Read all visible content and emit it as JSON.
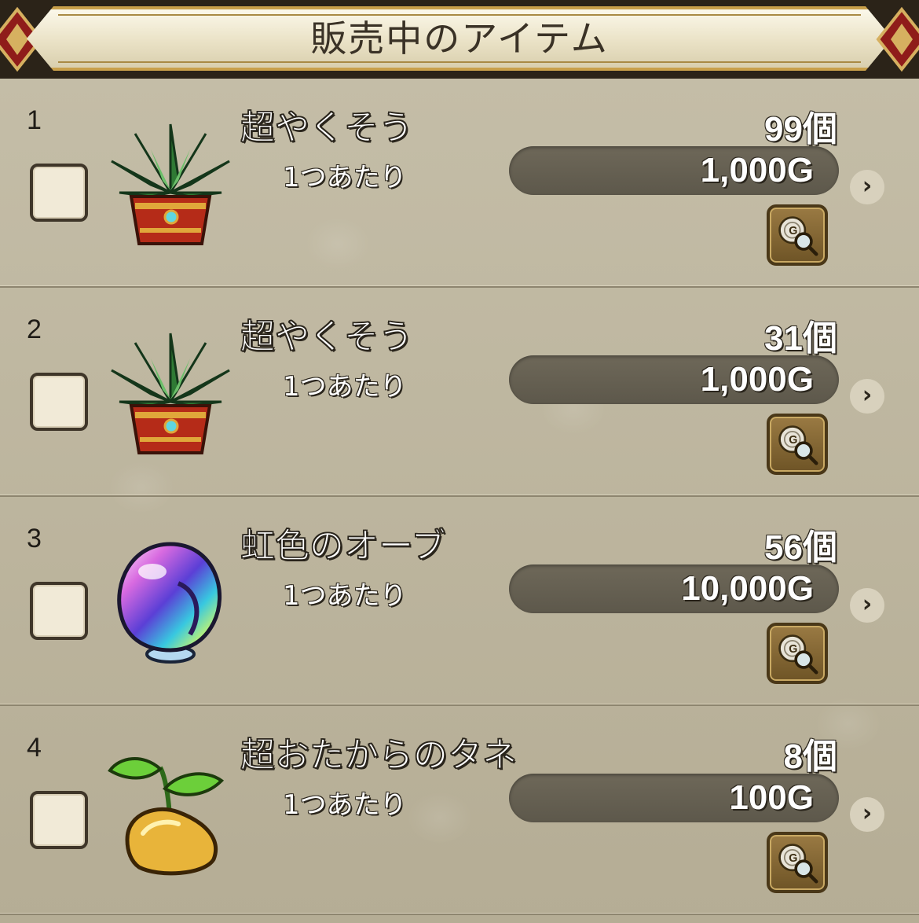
{
  "header": {
    "title": "販売中のアイテム"
  },
  "items": [
    {
      "number": "1",
      "name": "超やくそう",
      "quantity": "99個",
      "per_unit_label": "1つあたり",
      "price": "1,000G",
      "icon": "herb-icon"
    },
    {
      "number": "2",
      "name": "超やくそう",
      "quantity": "31個",
      "per_unit_label": "1つあたり",
      "price": "1,000G",
      "icon": "herb-icon"
    },
    {
      "number": "3",
      "name": "虹色のオーブ",
      "quantity": "56個",
      "per_unit_label": "1つあたり",
      "price": "10,000G",
      "icon": "rainbow-orb-icon"
    },
    {
      "number": "4",
      "name": "超おたからのタネ",
      "quantity": "8個",
      "per_unit_label": "1つあたり",
      "price": "100G",
      "icon": "seed-icon"
    }
  ],
  "colors": {
    "background": "#b9b29c",
    "header_plate": "#f2edd8",
    "gold_trim": "#c9a04a",
    "price_bar": "#66604f",
    "checkbox_fill": "#f1ead7"
  }
}
